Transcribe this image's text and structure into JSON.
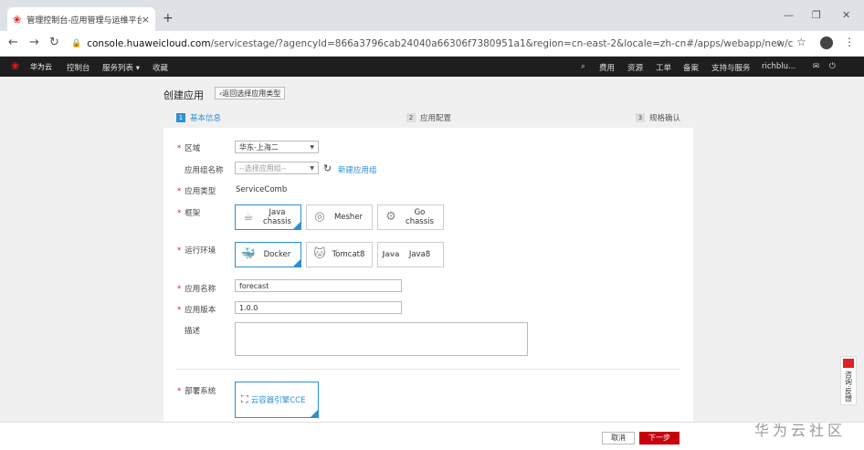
{
  "browser": {
    "tab_title": "管理控制台-应用管理与运维平台",
    "tab_close": "×",
    "new_tab": "+",
    "url_host": "console.huaweicloud.com",
    "url_path": "/servicestage/?agencyId=866a3796cab24040a66306f7380951a1&region=cn-east-2&locale=zh-cn#/apps/webapp/new/create?categ..."
  },
  "topnav": {
    "brand": "华为云",
    "items": [
      "控制台",
      "服务列表 ▾",
      "收藏"
    ],
    "right_items": [
      "费用",
      "资源",
      "工单",
      "备案",
      "支持与服务",
      "richblu..."
    ]
  },
  "page": {
    "title": "创建应用",
    "back_label": "返回选择应用类型"
  },
  "steps": [
    {
      "num": "1",
      "label": "基本信息"
    },
    {
      "num": "2",
      "label": "应用配置"
    },
    {
      "num": "3",
      "label": "规格确认"
    }
  ],
  "form": {
    "region_label": "区域",
    "region_value": "华东-上海二",
    "group_label": "应用组名称",
    "group_placeholder": "--选择应用组--",
    "new_group_link": "新建应用组",
    "apptype_label": "应用类型",
    "apptype_value": "ServiceComb",
    "framework_label": "框架",
    "frameworks": [
      "Java chassis",
      "Mesher",
      "Go chassis"
    ],
    "runtime_label": "运行环境",
    "runtimes": [
      "Docker",
      "Tomcat8",
      "Java8"
    ],
    "runtime_java_icon": "Java",
    "name_label": "应用名称",
    "name_value": "forecast",
    "version_label": "应用版本",
    "version_value": "1.0.0",
    "desc_label": "描述",
    "deploy_label": "部署系统",
    "deploy_value": "云容器引擎CCE"
  },
  "footer": {
    "cancel": "取消",
    "next": "下一步"
  },
  "watermark": "华为云社区",
  "feedback": "咨询·反馈",
  "colors": {
    "accent": "#2d8fd5",
    "primary": "#c7000b",
    "required": "#e02020"
  }
}
